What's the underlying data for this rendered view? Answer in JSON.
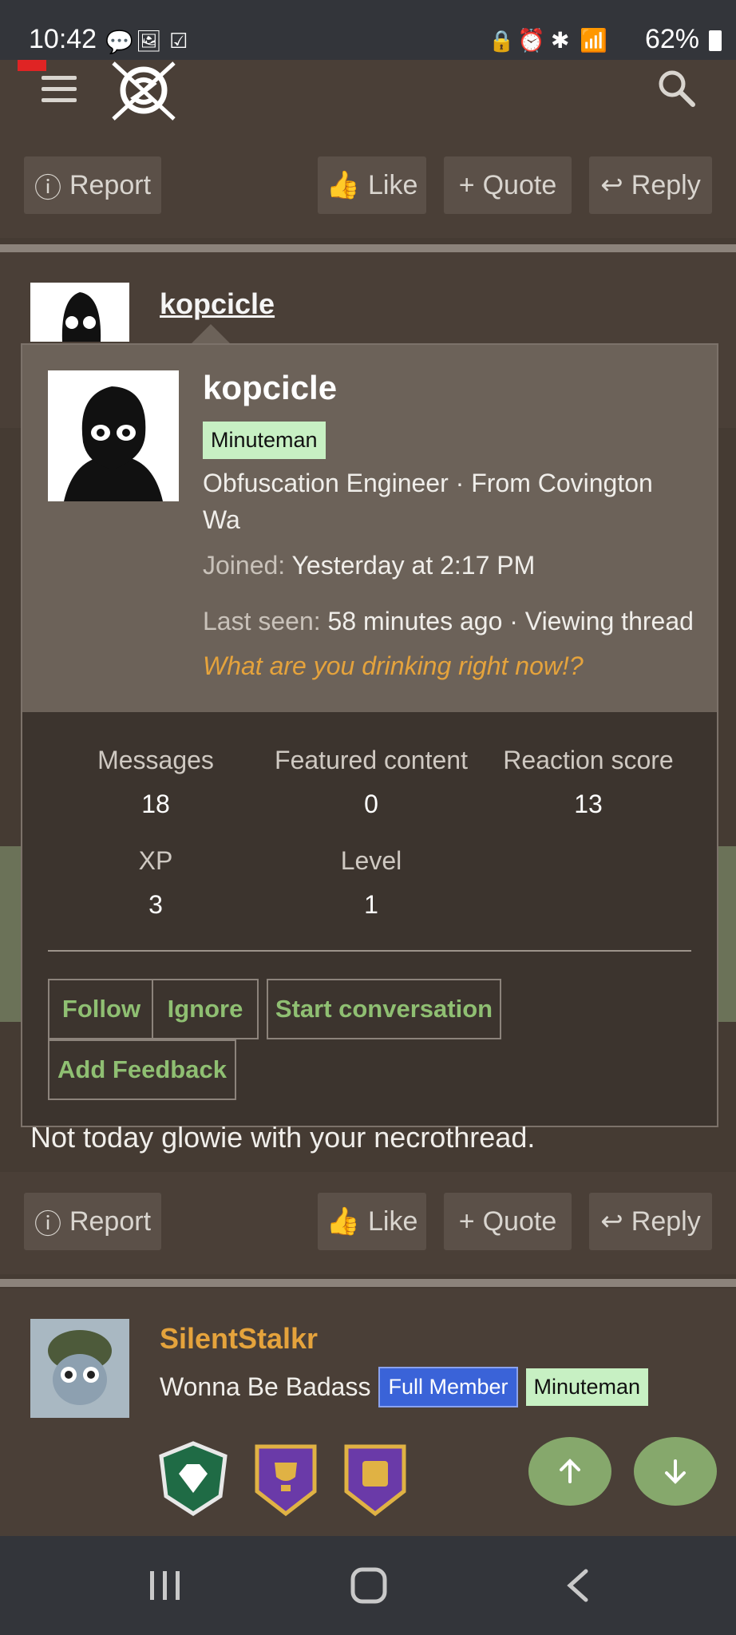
{
  "status_bar": {
    "time": "10:42",
    "battery": "62%"
  },
  "post_actions": {
    "report": "Report",
    "like": "Like",
    "quote": "Quote",
    "reply": "Reply"
  },
  "post_author": {
    "username": "kopcicle"
  },
  "profile_popup": {
    "name": "kopcicle",
    "badge": "Minuteman",
    "title_line": "Obfuscation Engineer · From Covington Wa",
    "joined_label": "Joined:",
    "joined_value": "Yesterday at 2:17 PM",
    "last_seen_label": "Last seen:",
    "last_seen_value": "58 minutes ago · Viewing thread",
    "last_seen_link": "What are you drinking right now!?",
    "stats": {
      "messages_label": "Messages",
      "messages_value": "18",
      "featured_label": "Featured content",
      "featured_value": "0",
      "reaction_label": "Reaction score",
      "reaction_value": "13",
      "xp_label": "XP",
      "xp_value": "3",
      "level_label": "Level",
      "level_value": "1"
    },
    "buttons": {
      "follow": "Follow",
      "ignore": "Ignore",
      "start_conversation": "Start conversation",
      "add_feedback": "Add Feedback"
    }
  },
  "post_body": {
    "text": "Not today glowie with your necrothread."
  },
  "next_post": {
    "username": "SilentStalkr",
    "title": "Wonna Be Badass",
    "badge_full": "Full Member",
    "badge_minuteman": "Minuteman"
  },
  "colors": {
    "accent_green": "#86a86c",
    "orange": "#e5a33c",
    "badge_green": "#c7f0c3",
    "badge_blue": "#3a63d8"
  }
}
